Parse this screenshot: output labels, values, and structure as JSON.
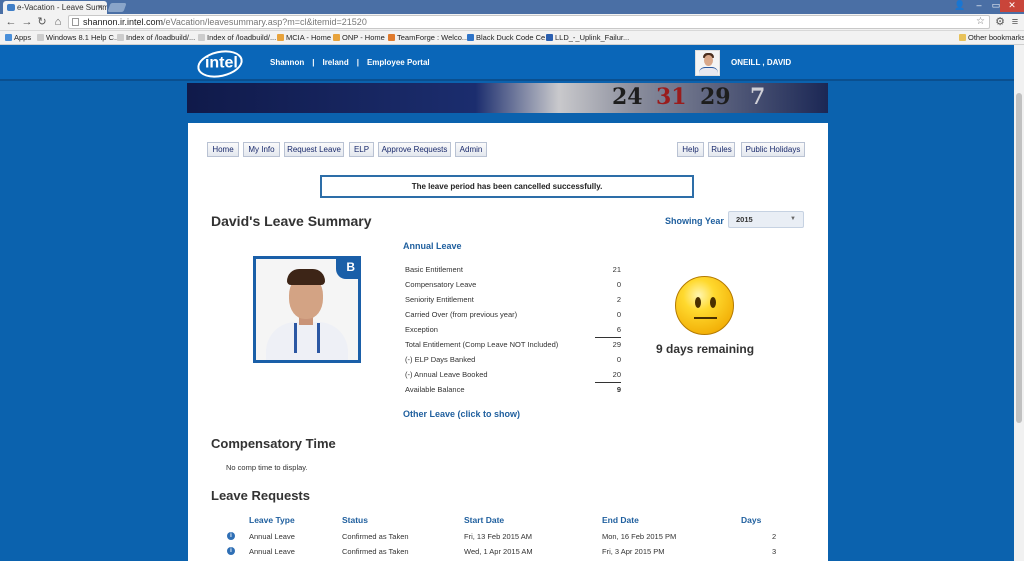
{
  "browser": {
    "tab_title": "e-Vacation - Leave Summ",
    "url_host": "shannon.ir.intel.com",
    "url_path": "/eVacation/leavesummary.asp?m=cl&itemid=21520",
    "bookmarks": [
      {
        "label": "Apps",
        "color": "#4a8fd9"
      },
      {
        "label": "Windows 8.1 Help C...",
        "color": "#cccccc"
      },
      {
        "label": "Index of /loadbuild/...",
        "color": "#cccccc"
      },
      {
        "label": "Index of /loadbuild/...",
        "color": "#cccccc"
      },
      {
        "label": "MCIA - Home",
        "color": "#e8a33c"
      },
      {
        "label": "ONP - Home",
        "color": "#e8a33c"
      },
      {
        "label": "TeamForge : Welco...",
        "color": "#e07b2e"
      },
      {
        "label": "Black Duck Code Ce...",
        "color": "#2e74c9"
      },
      {
        "label": "LLD_-_Uplink_Failur...",
        "color": "#2b5fb0"
      }
    ],
    "other_bookmarks": "Other bookmarks"
  },
  "header": {
    "logo_text": "intel",
    "nav": [
      "Shannon",
      "Ireland",
      "Employee Portal"
    ],
    "nav_separator": "|",
    "username": "ONEILL , DAVID"
  },
  "banner": {
    "numbers": [
      "24",
      "31",
      "29",
      "7"
    ]
  },
  "menu": {
    "left": [
      "Home",
      "My Info",
      "Request Leave",
      "ELP",
      "Approve Requests",
      "Admin"
    ],
    "right": [
      "Help",
      "Rules",
      "Public Holidays"
    ]
  },
  "notice": "The leave period has been cancelled successfully.",
  "summary": {
    "title": "David's Leave Summary",
    "showing_year_label": "Showing Year",
    "year": "2015",
    "photo_badge": "B"
  },
  "annual_leave": {
    "title": "Annual Leave",
    "rows": [
      {
        "label": "Basic Entitlement",
        "value": "21"
      },
      {
        "label": "Compensatory Leave",
        "value": "0"
      },
      {
        "label": "Seniority Entitlement",
        "value": "2"
      },
      {
        "label": "Carried Over (from previous year)",
        "value": "0"
      },
      {
        "label": "Exception",
        "value": "6"
      },
      {
        "label": "Total Entitlement (Comp Leave NOT Included)",
        "value": "29"
      },
      {
        "label": "(-) ELP Days Banked",
        "value": "0"
      },
      {
        "label": "(-) Annual Leave Booked",
        "value": "20"
      },
      {
        "label": "Available Balance",
        "value": "9"
      }
    ],
    "days_remaining": "9 days remaining",
    "other_leave_link": "Other Leave (click to show)"
  },
  "compensatory": {
    "title": "Compensatory Time",
    "empty_text": "No comp time to display."
  },
  "leave_requests": {
    "title": "Leave Requests",
    "columns": [
      "Leave Type",
      "Status",
      "Start Date",
      "End Date",
      "Days"
    ],
    "rows": [
      {
        "type": "Annual Leave",
        "status": "Confirmed as Taken",
        "start": "Fri, 13 Feb 2015 AM",
        "end": "Mon, 16 Feb 2015 PM",
        "days": "2"
      },
      {
        "type": "Annual Leave",
        "status": "Confirmed as Taken",
        "start": "Wed, 1 Apr 2015 AM",
        "end": "Fri, 3 Apr 2015 PM",
        "days": "3"
      }
    ]
  }
}
